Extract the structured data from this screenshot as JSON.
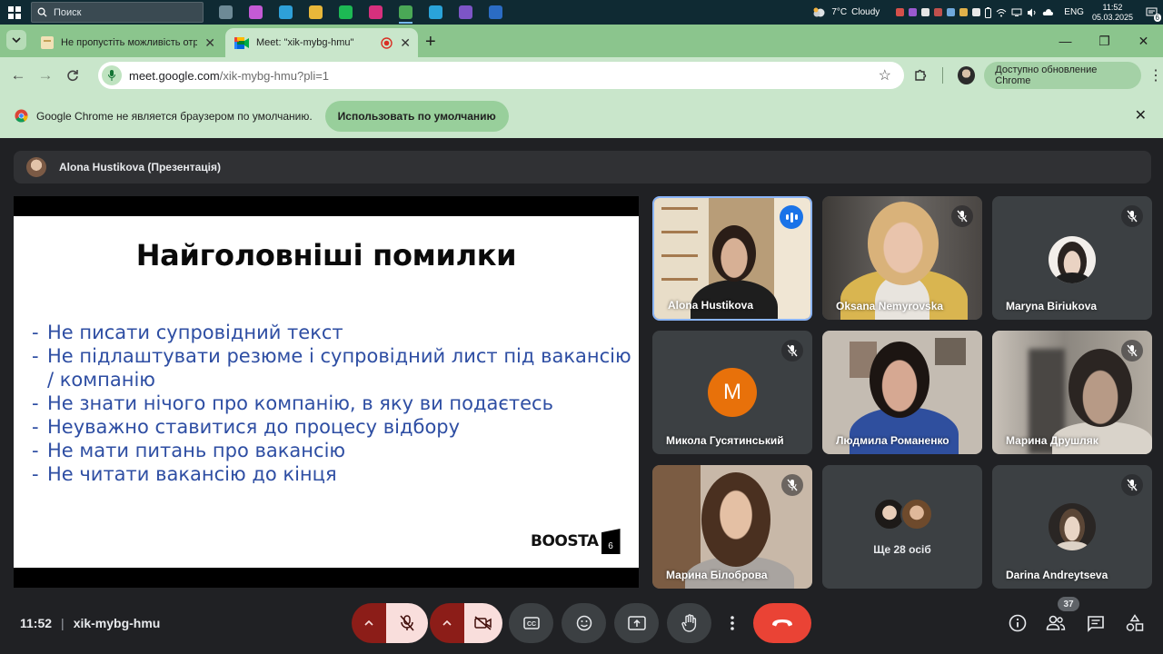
{
  "taskbar": {
    "search_placeholder": "Поиск",
    "weather": "7°C",
    "weather_desc": "Cloudy",
    "lang": "ENG",
    "time": "11:52",
    "date": "05.03.2025",
    "notifications": "6",
    "apps": [
      {
        "name": "task-view-icon",
        "color": "#6d8a96"
      },
      {
        "name": "copilot-app-icon",
        "color": "#c45ad6"
      },
      {
        "name": "edge-app-icon",
        "color": "#2ea0d8"
      },
      {
        "name": "file-explorer-app-icon",
        "color": "#e8b83a"
      },
      {
        "name": "spotify-app-icon",
        "color": "#1db954"
      },
      {
        "name": "instagram-app-icon",
        "color": "#d6307d"
      },
      {
        "name": "chrome-app-icon",
        "color": "#4aa856"
      },
      {
        "name": "telegram-app-icon",
        "color": "#2aa3d9"
      },
      {
        "name": "viber-app-icon",
        "color": "#7d55c7"
      },
      {
        "name": "word-app-icon",
        "color": "#2b6cc4"
      }
    ]
  },
  "browser": {
    "tabs": [
      {
        "title": "Не пропустіть можливість отр"
      },
      {
        "title": "Meet: \"xik-mybg-hmu\""
      }
    ],
    "url_host": "meet.google.com",
    "url_path": "/xik-mybg-hmu?pli=1",
    "update_label": "Доступно обновление Chrome",
    "infobar_text": "Google Chrome не является браузером по умолчанию.",
    "default_button": "Использовать по умолчанию"
  },
  "meet": {
    "presenter_label": "Alona Hustikova (Презентація)",
    "slide": {
      "title": "Найголовніші помилки",
      "bullets": [
        "Не писати супровідний текст",
        "Не підлаштувати резюме і супровідний лист під вакансію / компанію",
        "Не знати нічого про компанію, в яку ви подаєтесь",
        "Неуважно ставитися до процесу відбору",
        "Не мати питань про вакансію",
        "Не читати вакансію до кінця"
      ],
      "brand": "BOOSTA",
      "page_number": "6"
    },
    "participants": [
      {
        "name": "Alona Hustikova",
        "state": "speaking",
        "bg": "#c9b28e"
      },
      {
        "name": "Oksana Nemyrovska",
        "state": "muted",
        "bg": "#5a5550"
      },
      {
        "name": "Maryna Biriukova",
        "state": "muted",
        "bg": "#3c4043"
      },
      {
        "name": "Микола Гусятинський",
        "state": "muted",
        "initial": "M",
        "avatar_color": "#e8710a"
      },
      {
        "name": "Людмила Романенко",
        "state": "none",
        "bg": "#a49890"
      },
      {
        "name": "Марина Друшляк",
        "state": "muted",
        "bg": "#6b6862"
      },
      {
        "name": "Марина Білоброва",
        "state": "muted",
        "bg": "#8a7060"
      },
      {
        "name": "Darina Andreytseva",
        "state": "muted",
        "bg": "#3c4043"
      }
    ],
    "more_label": "Ще 28 осіб",
    "meeting_time": "11:52",
    "meeting_code": "xik-mybg-hmu",
    "people_count": "37"
  }
}
